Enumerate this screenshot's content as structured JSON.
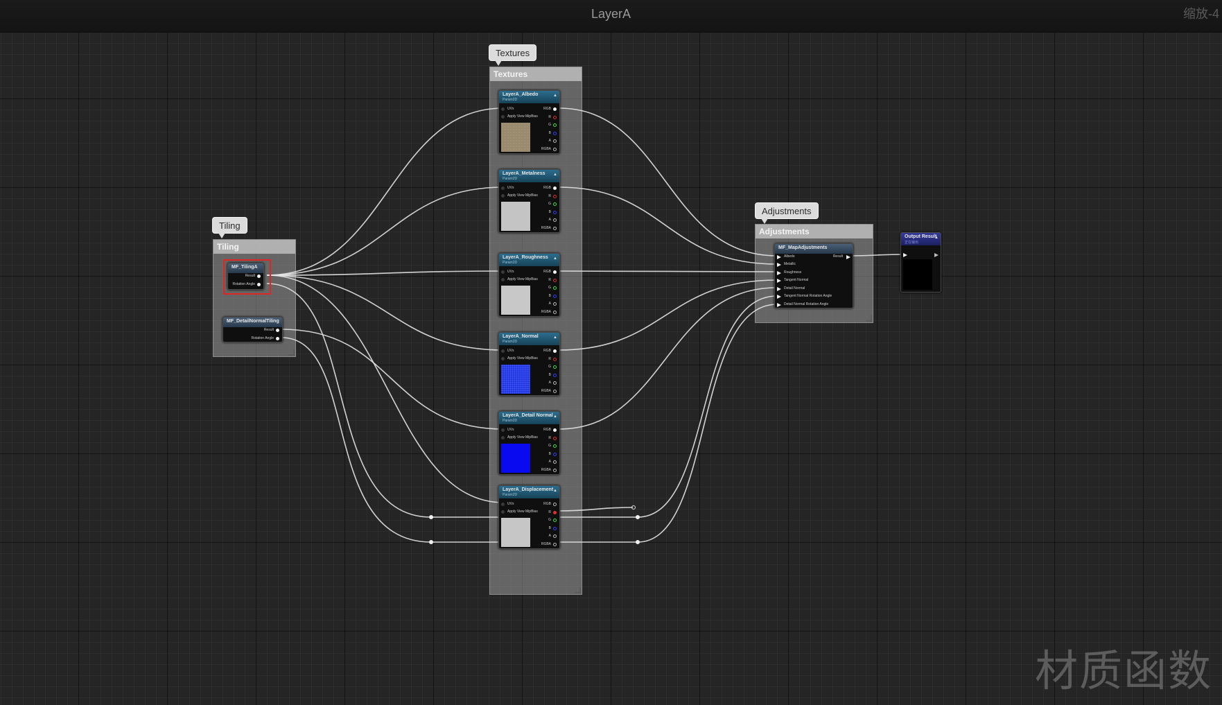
{
  "header": {
    "title": "LayerA",
    "zoom": "缩放-4"
  },
  "watermark": "材质函数",
  "comments": {
    "tiling": {
      "bubble": "Tiling",
      "title": "Tiling"
    },
    "textures": {
      "bubble": "Textures",
      "title": "Textures"
    },
    "adjustments": {
      "bubble": "Adjustments",
      "title": "Adjustments"
    }
  },
  "pin_labels": {
    "uvs": "UVs",
    "apply_mip": "Apply View MipBias",
    "rgb": "RGB",
    "r": "R",
    "g": "G",
    "b": "B",
    "a": "A",
    "rgba": "RGBA",
    "result": "Result",
    "rotation": "Rotation Angle"
  },
  "tiling_nodes": [
    {
      "title": "MF_TilingA"
    },
    {
      "title": "MF_DetailNormalTiling"
    }
  ],
  "texture_nodes": [
    {
      "title": "LayerA_Albedo",
      "subtitle": "Param2D",
      "preview": "#9a8a6e"
    },
    {
      "title": "LayerA_Metalness",
      "subtitle": "Param2D",
      "preview": "#c4c4c4"
    },
    {
      "title": "LayerA_Roughness",
      "subtitle": "Param2D",
      "preview": "#c8c8c8"
    },
    {
      "title": "LayerA_Normal",
      "subtitle": "Param2D",
      "preview": "#1626d8"
    },
    {
      "title": "LayerA_Detail Normal",
      "subtitle": "Param2D",
      "preview": "#0a0af0"
    },
    {
      "title": "LayerA_Displacement",
      "subtitle": "Param2D",
      "preview": "#c6c6c6"
    }
  ],
  "adjust_node": {
    "title": "MF_MapAdjustments",
    "inputs": [
      "Albedo",
      "Metallic",
      "Roughness",
      "Tangent Normal",
      "Detail Normal",
      "Tangent Normal Rotation Angle",
      "Detail Normal Rotation Angle"
    ],
    "output": "Result"
  },
  "output_node": {
    "title": "Output Result",
    "subtitle": "正在输出"
  },
  "colors": {
    "wire": "#e6e6e6",
    "param_header": "#2b6d8e",
    "function_header": "#4a5f75",
    "output_header": "#353a9a",
    "selection": "#e02525"
  }
}
